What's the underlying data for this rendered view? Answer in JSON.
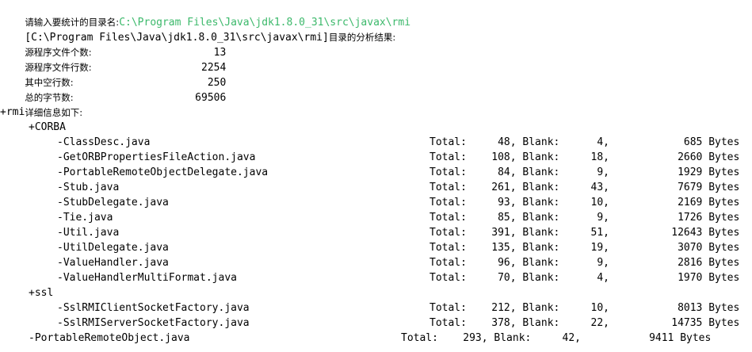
{
  "console": {
    "prompt_label": "请输入要统计的目录名:",
    "input_value": "C:\\Program Files\\Java\\jdk1.8.0_31\\src\\javax\\rmi",
    "result_path": "[C:\\Program Files\\Java\\jdk1.8.0_31\\src\\javax\\rmi]",
    "result_suffix": "目录的分析结果:",
    "summary": [
      {
        "label": "源程序文件个数:",
        "value": "13"
      },
      {
        "label": "源程序文件行数:",
        "value": "2254"
      },
      {
        "label": "其中空行数:",
        "value": "250"
      },
      {
        "label": "总的字节数:",
        "value": "69506"
      }
    ],
    "detail_header": "详细信息如下:",
    "tree": [
      {
        "name": "+rmi"
      },
      {
        "name": "+CORBA"
      },
      {
        "name": "-ClassDesc.java",
        "total": "48",
        "blank": "4",
        "bytes": "685"
      },
      {
        "name": "-GetORBPropertiesFileAction.java",
        "total": "108",
        "blank": "18",
        "bytes": "2660"
      },
      {
        "name": "-PortableRemoteObjectDelegate.java",
        "total": "84",
        "blank": "9",
        "bytes": "1929"
      },
      {
        "name": "-Stub.java",
        "total": "261",
        "blank": "43",
        "bytes": "7679"
      },
      {
        "name": "-StubDelegate.java",
        "total": "93",
        "blank": "10",
        "bytes": "2169"
      },
      {
        "name": "-Tie.java",
        "total": "85",
        "blank": "9",
        "bytes": "1726"
      },
      {
        "name": "-Util.java",
        "total": "391",
        "blank": "51",
        "bytes": "12643"
      },
      {
        "name": "-UtilDelegate.java",
        "total": "135",
        "blank": "19",
        "bytes": "3070"
      },
      {
        "name": "-ValueHandler.java",
        "total": "96",
        "blank": "9",
        "bytes": "2816"
      },
      {
        "name": "-ValueHandlerMultiFormat.java",
        "total": "70",
        "blank": "4",
        "bytes": "1970"
      },
      {
        "name": "+ssl"
      },
      {
        "name": "-SslRMIClientSocketFactory.java",
        "total": "212",
        "blank": "10",
        "bytes": "8013"
      },
      {
        "name": "-SslRMIServerSocketFactory.java",
        "total": "378",
        "blank": "22",
        "bytes": "14735"
      },
      {
        "name": "-PortableRemoteObject.java",
        "total": "293",
        "blank": "42",
        "bytes": "9411"
      }
    ],
    "labels": {
      "total": "Total:",
      "blank": "Blank:",
      "bytes": "Bytes"
    }
  }
}
